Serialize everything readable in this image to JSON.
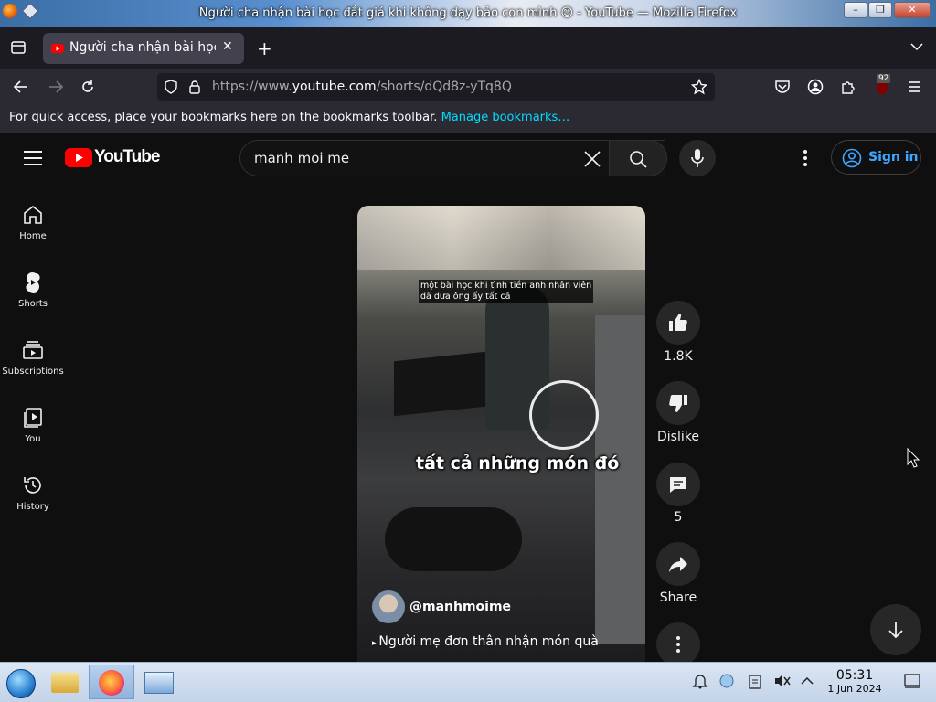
{
  "window": {
    "title": "Người cha nhận bài học đắt giá khi không dạy bảo con mình 😊 - YouTube — Mozilla Firefox",
    "min_label": "–",
    "max_label": "❐",
    "close_label": "✕"
  },
  "tab": {
    "title": "Người cha nhận bài học đắt giá khi không dạy bảo con mình 😊 - YouTube",
    "new_tab_label": "+",
    "close_label": "✕"
  },
  "nav": {
    "url_prefix": "https://www.",
    "url_host": "youtube.com",
    "url_path": "/shorts/dQd8z-yTq8Q",
    "extension_badge": "92"
  },
  "bookmarks": {
    "message": "For quick access, place your bookmarks here on the bookmarks toolbar.",
    "manage_link": "Manage bookmarks…"
  },
  "youtube": {
    "logo_text": "YouTube",
    "search_value": "manh moi me",
    "sign_in": "Sign in"
  },
  "sidebar": {
    "items": [
      {
        "label": "Home",
        "icon": "home-icon"
      },
      {
        "label": "Shorts",
        "icon": "shorts-icon"
      },
      {
        "label": "Subscriptions",
        "icon": "subscriptions-icon"
      },
      {
        "label": "You",
        "icon": "you-icon"
      },
      {
        "label": "History",
        "icon": "history-icon"
      }
    ]
  },
  "video": {
    "subtitle_line1": "một bài học khi tình tiền anh nhân viên",
    "subtitle_line2": "đã đưa ông ấy tất cả",
    "caption": "tất cả những món đó",
    "channel": "@manhmoime",
    "sound": "Người mẹ đơn thân nhận món quà"
  },
  "actions": {
    "likes": "1.8K",
    "dislike": "Dislike",
    "comments": "5",
    "share": "Share"
  },
  "taskbar": {
    "time": "05:31",
    "date": "1 Jun 2024"
  }
}
